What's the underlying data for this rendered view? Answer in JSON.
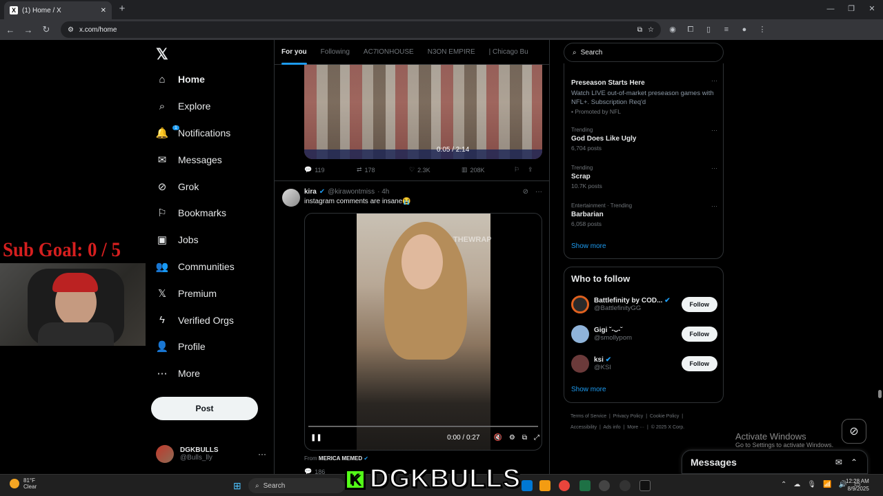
{
  "browser": {
    "tab_title": "(1) Home / X",
    "tab_favicon": "X",
    "url": "x.com/home"
  },
  "overlay": {
    "sub_goal": "Sub Goal:  0 / 5",
    "stream_name": "DGKBULLS",
    "kick_letter": "K"
  },
  "sidebar": {
    "logo": "𝕏",
    "items": [
      {
        "label": "Home",
        "icon": "home-icon",
        "glyph": "⌂"
      },
      {
        "label": "Explore",
        "icon": "search-icon",
        "glyph": "⌕"
      },
      {
        "label": "Notifications",
        "icon": "bell-icon",
        "glyph": "🔔"
      },
      {
        "label": "Messages",
        "icon": "envelope-icon",
        "glyph": "✉"
      },
      {
        "label": "Grok",
        "icon": "grok-icon",
        "glyph": "⊘"
      },
      {
        "label": "Bookmarks",
        "icon": "bookmark-icon",
        "glyph": "⚐"
      },
      {
        "label": "Jobs",
        "icon": "briefcase-icon",
        "glyph": "▣"
      },
      {
        "label": "Communities",
        "icon": "people-icon",
        "glyph": "👥"
      },
      {
        "label": "Premium",
        "icon": "x-premium-icon",
        "glyph": "𝕏"
      },
      {
        "label": "Verified Orgs",
        "icon": "lightning-icon",
        "glyph": "ϟ"
      },
      {
        "label": "Profile",
        "icon": "person-icon",
        "glyph": "👤"
      },
      {
        "label": "More",
        "icon": "more-circle-icon",
        "glyph": "⋯"
      }
    ],
    "notification_count": "1",
    "post_label": "Post",
    "account": {
      "name": "DGKBULLS",
      "handle": "@Bulls_lly"
    }
  },
  "feed": {
    "tabs": [
      "For you",
      "Following",
      "AC7IONHOUSE",
      "N3ON EMPIRE",
      "| Chicago Bu"
    ],
    "tweet1": {
      "video_time": "0:05 / 2:14",
      "replies": "119",
      "reposts": "178",
      "likes": "2.3K",
      "views": "208K"
    },
    "tweet2": {
      "name": "kira",
      "handle": "@kirawontmiss",
      "age": "· 4h",
      "text": "instagram comments are insane😭",
      "video_time": "0:00 / 0:27",
      "watermark": "THEWRAP",
      "from_label": "From",
      "from_source": "MERICA MEMED",
      "replies": "186"
    }
  },
  "right": {
    "search_placeholder": "Search",
    "trends": [
      {
        "meta": "",
        "title": "Preseason Starts Here",
        "desc": "Watch LIVE out-of-market preseason games with NFL+. Subscription Req'd",
        "count": "Promoted by NFL"
      },
      {
        "meta": "Trending",
        "title": "God Does Like Ugly",
        "desc": "",
        "count": "6,704 posts"
      },
      {
        "meta": "Trending",
        "title": "Scrap",
        "desc": "",
        "count": "10.7K posts"
      },
      {
        "meta": "Entertainment · Trending",
        "title": "Barbarian",
        "desc": "",
        "count": "6,058 posts"
      }
    ],
    "show_more": "Show more",
    "who_to_follow": "Who to follow",
    "follow": [
      {
        "name": "Battlefinity by COD...",
        "handle": "@BattlefinityGG",
        "color": "#2a2a2a"
      },
      {
        "name": "Gigi ˘-ᴗ-˘",
        "handle": "@smollypom",
        "color": "#8fb3d9"
      },
      {
        "name": "ksi",
        "handle": "@KSI",
        "color": "#6b3a3a"
      }
    ],
    "follow_label": "Follow",
    "footer": [
      "Terms of Service",
      "Privacy Policy",
      "Cookie Policy",
      "Accessibility",
      "Ads info",
      "More ···",
      "© 2025 X Corp."
    ]
  },
  "windows": {
    "activate_title": "Activate Windows",
    "activate_sub": "Go to Settings to activate Windows.",
    "weather_temp": "81°F",
    "weather_desc": "Clear",
    "weather_badge": "4",
    "taskbar_search": "Search",
    "time": "12:28 AM",
    "date": "8/9/2025"
  },
  "messages_dock": "Messages",
  "colors": {
    "accent": "#1d9bf0",
    "kick": "#53fc18",
    "subgoal": "#d61f1f"
  }
}
